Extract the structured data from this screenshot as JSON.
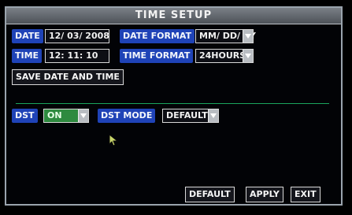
{
  "window": {
    "title": "TIME SETUP"
  },
  "labels": {
    "date": "DATE",
    "date_format": "DATE FORMAT",
    "time": "TIME",
    "time_format": "TIME FORMAT",
    "dst": "DST",
    "dst_mode": "DST MODE"
  },
  "values": {
    "date": "12/ 03/ 2008",
    "time": "12: 11: 10",
    "date_format": "MM/ DD/ YY",
    "time_format": "24HOURS",
    "dst": "ON",
    "dst_mode": "DEFAULT"
  },
  "buttons": {
    "save_date_time": "SAVE DATE AND TIME",
    "default": "DEFAULT",
    "apply": "APPLY",
    "exit": "EXIT"
  },
  "colors": {
    "label_bg": "#1f43b7",
    "separator": "#1aa55c",
    "dst_on_bg": "#2e8a3f"
  }
}
